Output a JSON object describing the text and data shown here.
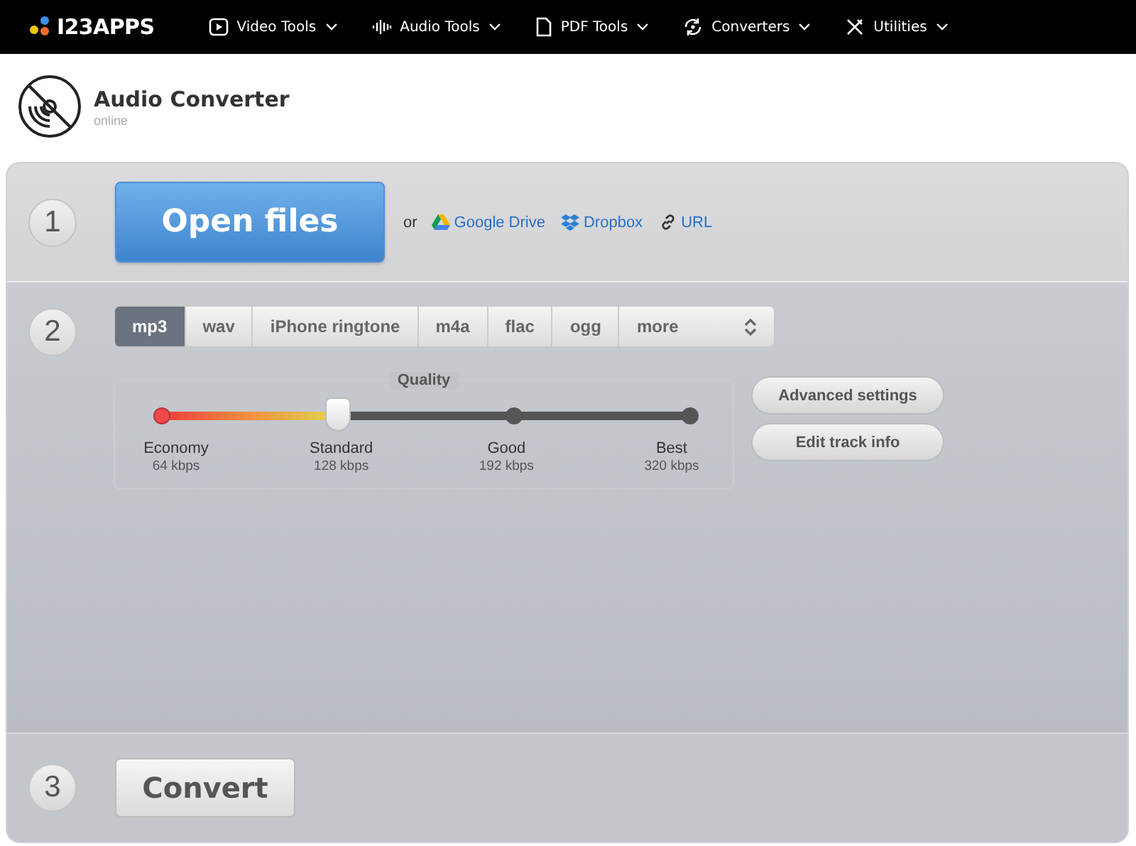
{
  "nav": {
    "logo": "I23APPS",
    "items": [
      {
        "label": "Video Tools",
        "kind": "video"
      },
      {
        "label": "Audio Tools",
        "kind": "audio"
      },
      {
        "label": "PDF Tools",
        "kind": "pdf"
      },
      {
        "label": "Converters",
        "kind": "convert"
      },
      {
        "label": "Utilities",
        "kind": "tools"
      }
    ]
  },
  "header": {
    "title": "Audio Converter",
    "subtitle": "online"
  },
  "steps": [
    {
      "number": "1"
    },
    {
      "number": "2"
    },
    {
      "number": "3"
    }
  ],
  "open": {
    "button": "Open files",
    "or": "or",
    "sources": [
      {
        "label": "Google Drive",
        "kind": "drive"
      },
      {
        "label": "Dropbox",
        "kind": "dropbox"
      },
      {
        "label": "URL",
        "kind": "link"
      }
    ]
  },
  "formats": [
    {
      "label": "mp3",
      "selected": true
    },
    {
      "label": "wav",
      "selected": false
    },
    {
      "label": "iPhone ringtone",
      "selected": false
    },
    {
      "label": "m4a",
      "selected": false
    },
    {
      "label": "flac",
      "selected": false
    },
    {
      "label": "ogg",
      "selected": false
    },
    {
      "label": "more",
      "selected": false,
      "kind": "dropdown"
    }
  ],
  "quality": {
    "title": "Quality",
    "level": 0.333,
    "stops": [
      {
        "name": "Economy",
        "rate": "64 kbps"
      },
      {
        "name": "Standard",
        "rate": "128 kbps"
      },
      {
        "name": "Good",
        "rate": "192 kbps"
      },
      {
        "name": "Best",
        "rate": "320 kbps"
      }
    ]
  },
  "side_buttons": [
    "Advanced settings",
    "Edit track info"
  ],
  "convert": {
    "button": "Convert"
  }
}
